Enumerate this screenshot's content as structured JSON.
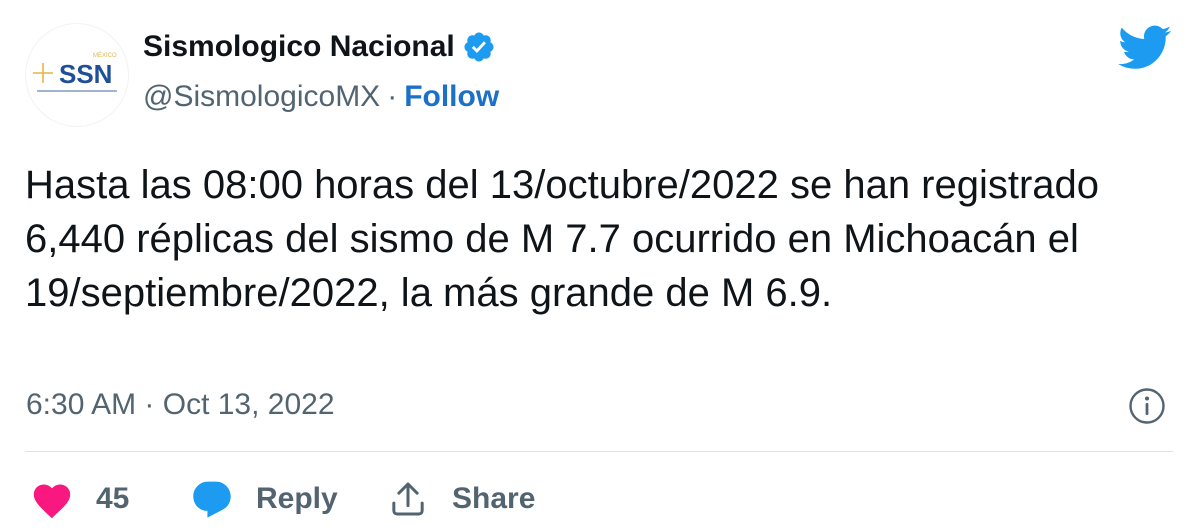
{
  "colors": {
    "text": "#0f1419",
    "secondary": "#536471",
    "link": "#1d70c8",
    "verified": "#1d9bf0",
    "twitter_brand": "#1d9bf0",
    "like": "#f91880",
    "reply_bubble": "#1d9bf0",
    "divider": "#dde3e8",
    "logo_blue": "#1f4f99",
    "logo_gold": "#e2b646"
  },
  "author": {
    "avatar_icon": "ssn-logo",
    "avatar_logo": {
      "small_text": "MÉXICO",
      "main_text": "SSN"
    },
    "name": "Sismologico Nacional",
    "verified_icon": "verified-badge-icon",
    "handle": "@SismologicoMX",
    "separator": "·",
    "follow_label": "Follow"
  },
  "brand_icon": "twitter-bird-icon",
  "tweet": {
    "text": "Hasta las 08:00 horas del 13/octubre/2022 se han registrado 6,440 réplicas del sismo de M 7.7 ocurrido en Michoacán el 19/septiembre/2022, la más grande de M 6.9.",
    "timestamp": "6:30 AM · Oct 13, 2022",
    "info_icon": "info-icon"
  },
  "actions": {
    "like": {
      "icon": "heart-icon",
      "count": "45"
    },
    "reply": {
      "icon": "reply-bubble-icon",
      "label": "Reply"
    },
    "share": {
      "icon": "share-icon",
      "label": "Share"
    }
  }
}
